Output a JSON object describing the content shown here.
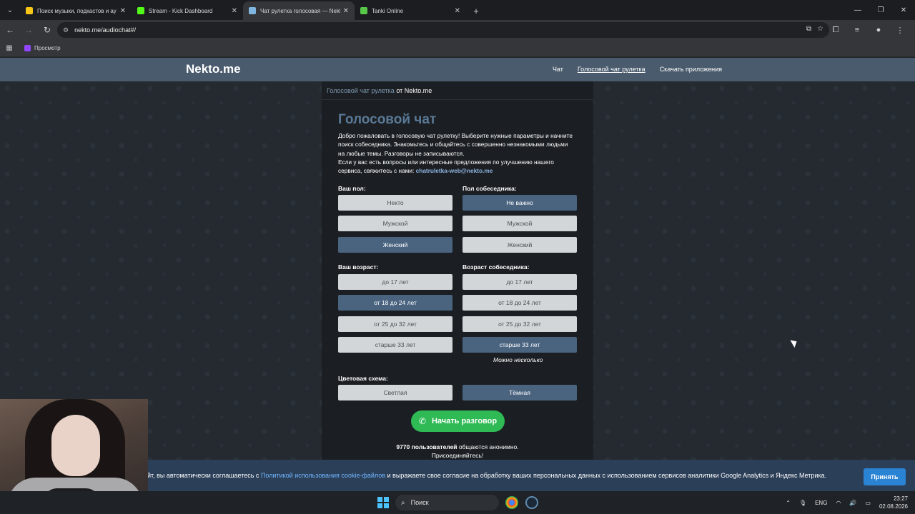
{
  "browser": {
    "tabs": [
      {
        "title": "Поиск музыки, подкастов и ау",
        "favicon_color": "#f5c518",
        "active": false
      },
      {
        "title": "Stream - Kick Dashboard",
        "favicon_color": "#53fc18",
        "active": false
      },
      {
        "title": "Чат рулетка голосовая — Nekt",
        "favicon_color": "#7fb7e0",
        "active": true
      },
      {
        "title": "Tanki Online",
        "favicon_color": "#57c84a",
        "active": false
      }
    ],
    "url": "nekto.me/audiochat#/",
    "bookmark": "Просмотр"
  },
  "site": {
    "logo": "Nekto.me",
    "nav": [
      "Чат",
      "Голосовой чат рулетка",
      "Скачать приложения"
    ],
    "breadcrumb_link": "Голосовой чат рулетка",
    "breadcrumb_rest": " от Nekto.me"
  },
  "chat": {
    "heading": "Голосовой чат",
    "intro_text": "Добро пожаловать в голосовую чат рулетку! Выберите нужные параметры и начните поиск собеседника. Знакомьтесь и общайтесь с совершенно незнакомыми людьми на любые темы. Разговоры не записываются.",
    "contact_text": "Если у вас есть вопросы или интересные предложения по улучшению нашего сервиса, свяжитесь с нами: ",
    "email": "chatruletka-web@nekto.me",
    "your_gender_label": "Ваш пол:",
    "partner_gender_label": "Пол собеседника:",
    "your_gender": [
      "Некто",
      "Мужской",
      "Женский"
    ],
    "your_gender_selected": "Женский",
    "partner_gender": [
      "Не важно",
      "Мужской",
      "Женский"
    ],
    "partner_gender_selected": "Не важно",
    "your_age_label": "Ваш возраст:",
    "partner_age_label": "Возраст собеседника:",
    "your_age": [
      "до 17 лет",
      "от 18 до 24 лет",
      "от 25 до 32 лет",
      "старше 33 лет"
    ],
    "your_age_selected": "от 18 до 24 лет",
    "partner_age": [
      "до 17 лет",
      "от 18 до 24 лет",
      "от 25 до 32 лет",
      "старше 33 лет"
    ],
    "partner_age_selected": "старше 33 лет",
    "multi_hint": "Можно несколько",
    "scheme_label": "Цветовая схема:",
    "scheme_light": "Светлая",
    "scheme_dark": "Тёмная",
    "scheme_selected": "Тёмная",
    "start_button": "Начать разговор",
    "users_count": "9770 пользователей",
    "users_rest": " общаются анонимно.",
    "join_text": "Присоединяйтесь!"
  },
  "cookie": {
    "text_before": "йт, вы автоматически соглашаетесь с ",
    "link": "Политикой использования cookie-файлов",
    "text_after": " и выражаете свое согласие на обработку ваших персональных данных с использованием сервисов аналитики Google Analytics и Яндекс Метрика.",
    "accept": "Принять"
  },
  "taskbar": {
    "search_placeholder": "Поиск",
    "lang": "ENG",
    "time": "23:27",
    "date": "02.08.2026"
  },
  "colors": {
    "header": "#4a5b6d",
    "selected_option": "#4a6480",
    "unselected_option": "#d3d6d9",
    "start_button": "#2fba55",
    "cookie_bar": "#2c3f58",
    "accept_button": "#2b83d4"
  }
}
